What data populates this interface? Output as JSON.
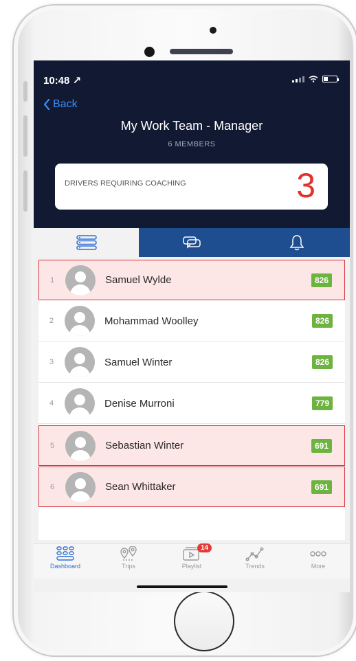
{
  "status": {
    "time": "10:48 ↗"
  },
  "nav": {
    "back_label": "Back",
    "title": "My Work Team - Manager",
    "subtitle": "6 MEMBERS"
  },
  "coaching": {
    "label": "DRIVERS REQUIRING COACHING",
    "count": "3",
    "count_color": "#e2332b"
  },
  "tabs": [
    {
      "icon": "list-icon"
    },
    {
      "icon": "chat-icon"
    },
    {
      "icon": "bell-icon"
    }
  ],
  "members": [
    {
      "rank": "1",
      "name": "Samuel Wylde",
      "score": "826",
      "flagged": true
    },
    {
      "rank": "2",
      "name": "Mohammad Woolley",
      "score": "826",
      "flagged": false
    },
    {
      "rank": "3",
      "name": "Samuel Winter",
      "score": "826",
      "flagged": false
    },
    {
      "rank": "4",
      "name": "Denise Murroni",
      "score": "779",
      "flagged": false
    },
    {
      "rank": "5",
      "name": "Sebastian Winter",
      "score": "691",
      "flagged": true
    },
    {
      "rank": "6",
      "name": "Sean Whittaker",
      "score": "691",
      "flagged": true
    }
  ],
  "tabbar": [
    {
      "label": "Dashboard",
      "icon": "dashboard-icon",
      "active": true
    },
    {
      "label": "Trips",
      "icon": "trips-icon",
      "active": false
    },
    {
      "label": "Playlist",
      "icon": "playlist-icon",
      "active": false,
      "badge": "14"
    },
    {
      "label": "Trends",
      "icon": "trends-icon",
      "active": false
    },
    {
      "label": "More",
      "icon": "more-icon",
      "active": false
    }
  ],
  "colors": {
    "header_bg": "#121a33",
    "accent": "#2f6fd6",
    "score_badge": "#6db33f",
    "flag_border": "#d8323c"
  }
}
